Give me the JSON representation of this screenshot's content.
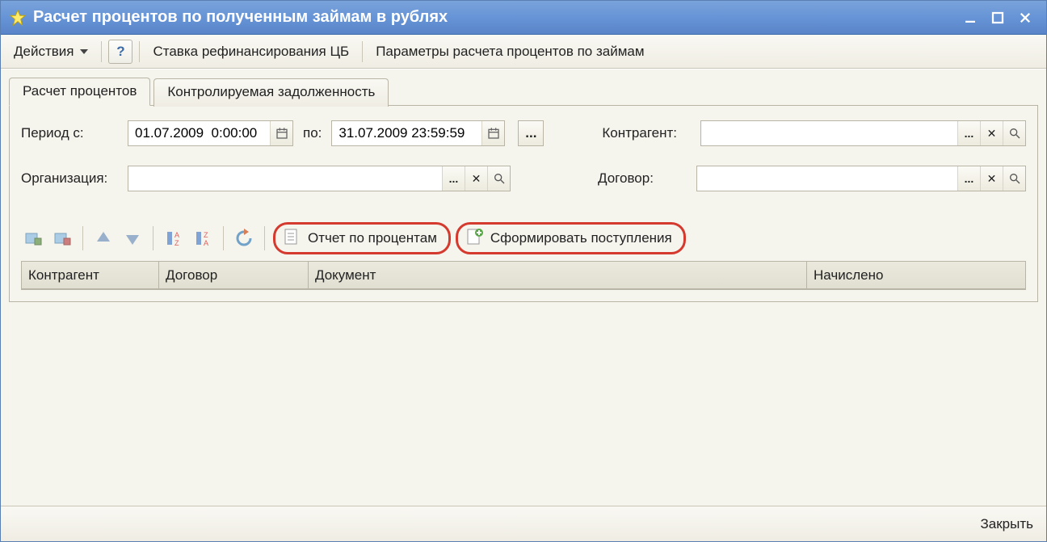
{
  "titlebar": {
    "title": "Расчет процентов по полученным займам в рублях"
  },
  "menubar": {
    "actions": "Действия",
    "refinance_rate": "Ставка рефинансирования ЦБ",
    "calc_params": "Параметры расчета процентов по займам"
  },
  "tabs": {
    "calc": "Расчет процентов",
    "controlled_debt": "Контролируемая задолженность"
  },
  "form": {
    "period_from_label": "Период с:",
    "period_from_value": "01.07.2009  0:00:00",
    "period_to_label": "по:",
    "period_to_value": "31.07.2009 23:59:59",
    "org_label": "Организация:",
    "org_value": "",
    "counterparty_label": "Контрагент:",
    "counterparty_value": "",
    "contract_label": "Договор:",
    "contract_value": ""
  },
  "toolbar": {
    "report_label": "Отчет по процентам",
    "generate_label": "Сформировать поступления"
  },
  "grid": {
    "columns": {
      "counterparty": "Контрагент",
      "contract": "Договор",
      "document": "Документ",
      "accrued": "Начислено"
    },
    "rows": []
  },
  "footer": {
    "close": "Закрыть"
  }
}
